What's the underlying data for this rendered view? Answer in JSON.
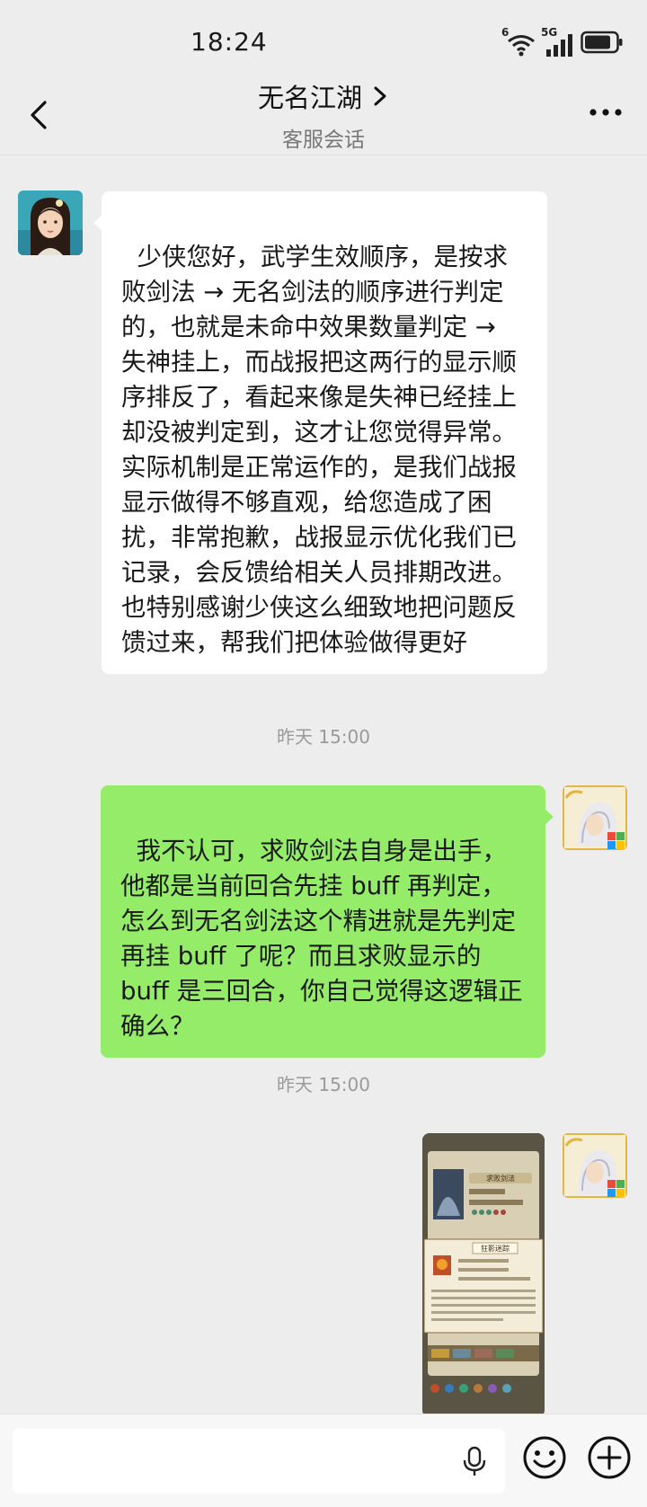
{
  "status_bar": {
    "time": "18:24",
    "network_badges": [
      "6",
      "5G"
    ],
    "icons": [
      "wifi-icon",
      "signal-icon",
      "battery-icon"
    ]
  },
  "header": {
    "title": "无名江湖",
    "subtitle": "客服会话",
    "icons": [
      "back-arrow-icon",
      "chevron-right-icon",
      "more-dots-icon"
    ]
  },
  "messages": [
    {
      "sender": "service",
      "type": "text",
      "text": "少侠您好，武学生效顺序，是按求败剑法 → 无名剑法的顺序进行判定的，也就是未命中效果数量判定 → 失神挂上，而战报把这两行的显示顺序排反了，看起来像是失神已经挂上却没被判定到，这才让您觉得异常。实际机制是正常运作的，是我们战报显示做得不够直观，给您造成了困扰，非常抱歉，战报显示优化我们已记录，会反馈给相关人员排期改进。也特别感谢少侠这么细致地把问题反馈过来，帮我们把体验做得更好"
    },
    {
      "type": "timestamp",
      "text": "昨天 15:00"
    },
    {
      "sender": "me",
      "type": "text",
      "text": "我不认可，求败剑法自身是出手，他都是当前回合先挂 buff 再判定，怎么到无名剑法这个精进就是先判定再挂 buff 了呢？而且求败显示的 buff 是三回合，你自己觉得这逻辑正确么？"
    },
    {
      "type": "timestamp",
      "text": "昨天 15:00"
    },
    {
      "sender": "me",
      "type": "image",
      "image_title": "求败剑法",
      "popup_title": "狂影迷踪"
    }
  ],
  "input_bar": {
    "icons": [
      "mic-icon",
      "emoji-icon",
      "plus-icon"
    ]
  }
}
